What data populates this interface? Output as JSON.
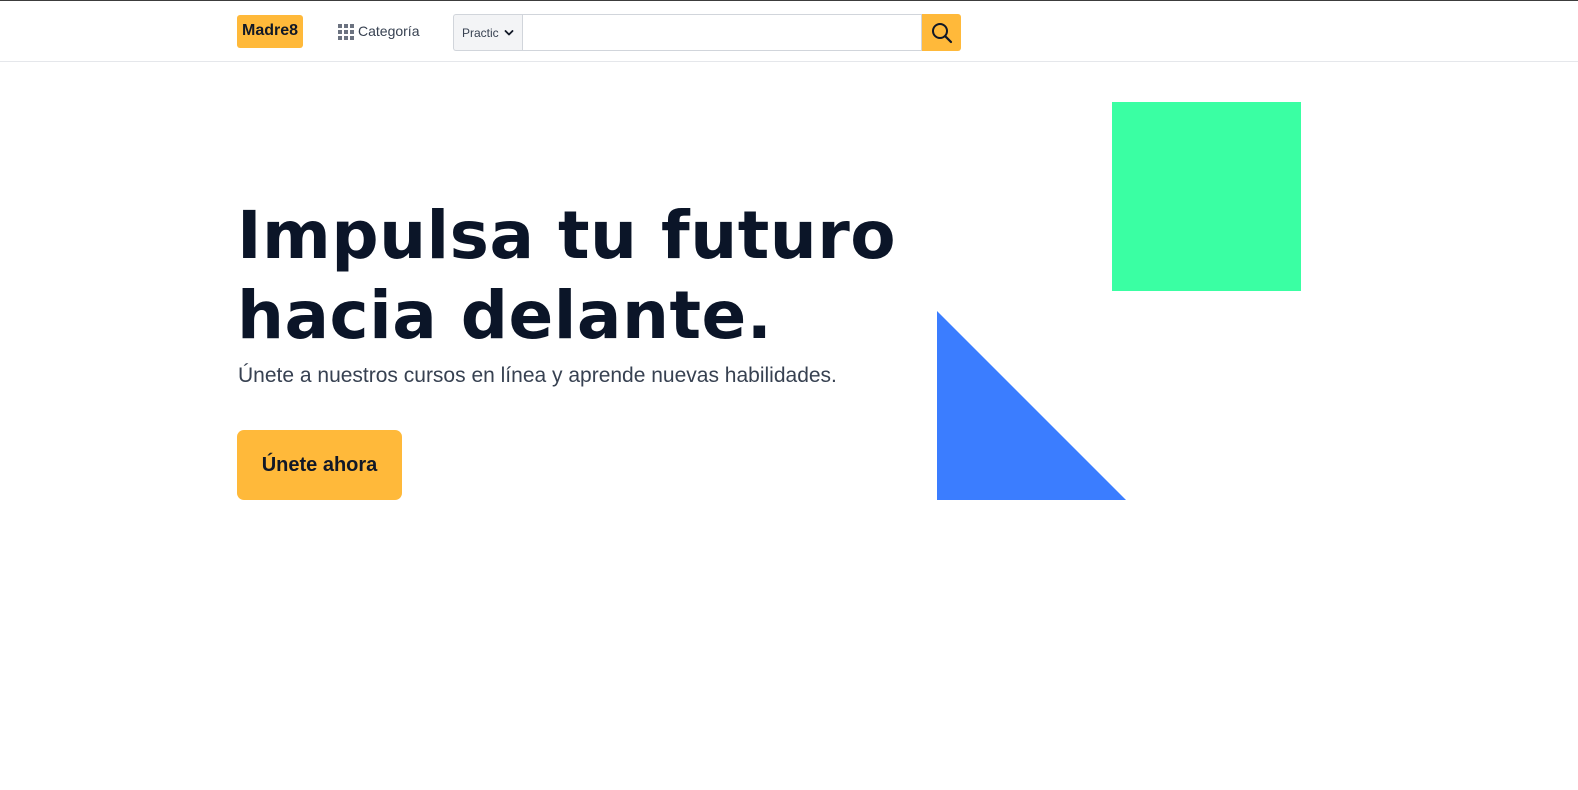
{
  "brand": {
    "logo_text": "Madre8",
    "accent_color": "#ffb93a"
  },
  "nav": {
    "category_icon": "grid-icon",
    "category_label": "Categoría"
  },
  "search": {
    "select_value": "Practic",
    "select_icon": "chevron-down-icon",
    "input_value": "",
    "button_icon": "search-icon"
  },
  "hero": {
    "title_line1": "Impulsa tu futuro",
    "title_line2": "hacia delante.",
    "subtitle": "Únete a nuestros cursos en línea y aprende nuevas habilidades.",
    "cta_label": "Únete ahora"
  },
  "decorations": {
    "square_color": "#3affa3",
    "triangle_color": "#3b7dff"
  }
}
